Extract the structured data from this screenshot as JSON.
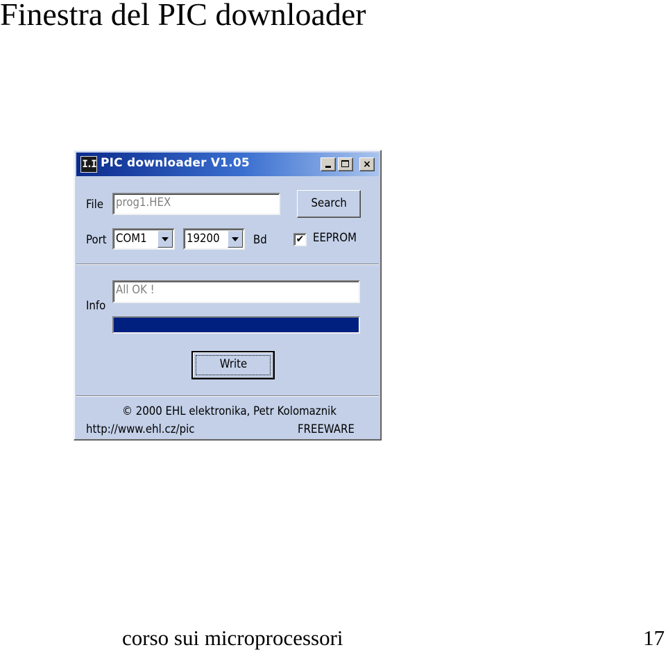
{
  "slide": {
    "title": "Finestra del PIC downloader",
    "footer": "corso sui microprocessori",
    "page_number": "17"
  },
  "window": {
    "title": "PIC downloader V1.05",
    "icon_glyph": "I.I",
    "controls": {
      "minimize": "minimize-icon",
      "maximize": "maximize-icon",
      "close": "×"
    },
    "file": {
      "label": "File",
      "value": "prog1.HEX",
      "search_button": "Search"
    },
    "port": {
      "label": "Port",
      "port_selected": "COM1",
      "baud_selected": "19200",
      "baud_unit": "Bd",
      "eeprom_label": "EEPROM",
      "eeprom_checked": true,
      "check_glyph": "✔"
    },
    "info": {
      "label": "Info",
      "status": "All OK !",
      "progress_fraction": 1.0
    },
    "write_button": "Write",
    "footer": {
      "copyright": "© 2000 EHL elektronika, Petr Kolomaznik",
      "url": "http://www.ehl.cz/pic",
      "license": "FREEWARE"
    },
    "colors": {
      "titlebar_start": "#0a2a8c",
      "titlebar_end": "#a9c4ee",
      "background": "#c3d0e8",
      "progress": "#002080"
    }
  }
}
